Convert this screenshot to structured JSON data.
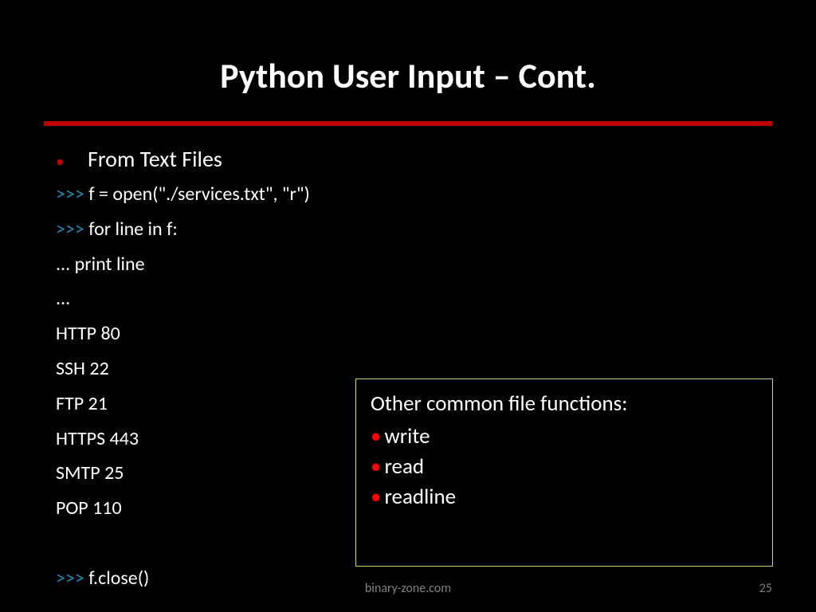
{
  "title": "Python User Input – Cont.",
  "heading_bullet": "From Text Files",
  "prompt": ">>>",
  "dots": "...",
  "code": {
    "line1": " f = open(\"./services.txt\", \"r\")",
    "line2": " for line in f:",
    "line3": "     print line",
    "line4": "",
    "out1": "HTTP 80",
    "out2": "SSH 22",
    "out3": "FTP 21",
    "out4": "HTTPS 443",
    "out5": "SMTP 25",
    "out6": "POP 110",
    "close": " f.close()"
  },
  "callout": {
    "title": "Other common file functions:",
    "items": [
      "write",
      "read",
      "readline"
    ]
  },
  "footer": {
    "center": "binary-zone.com",
    "page": "25"
  }
}
